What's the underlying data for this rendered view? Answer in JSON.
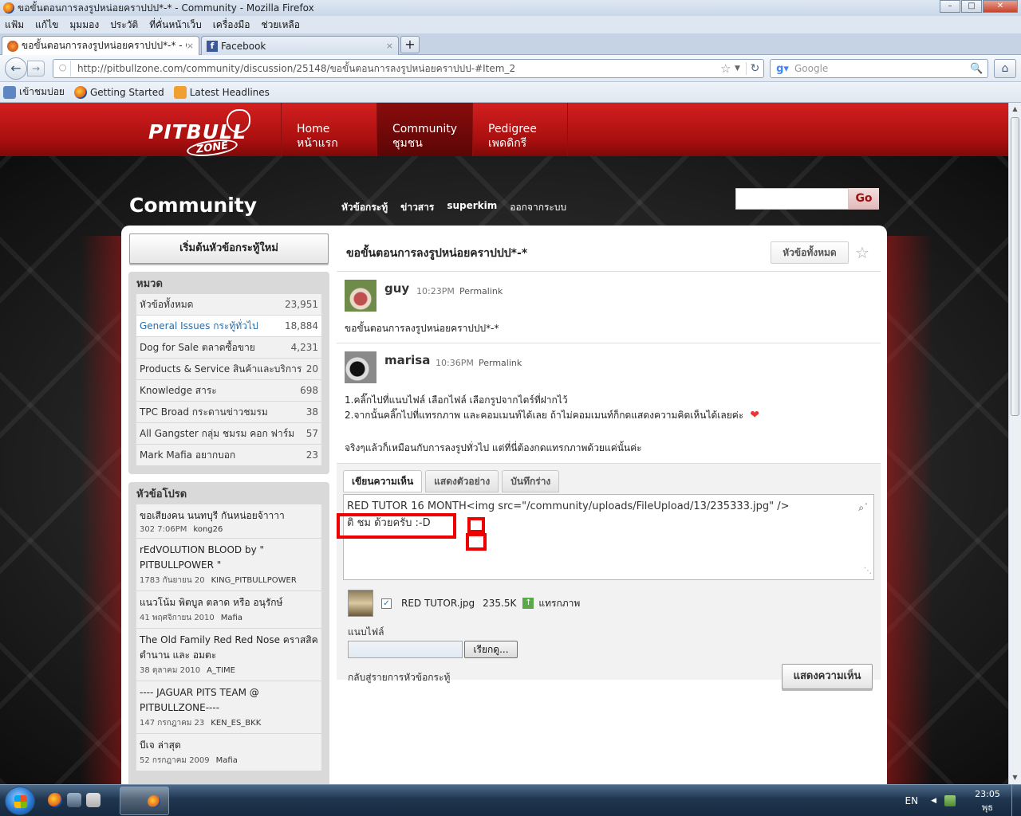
{
  "window": {
    "title": "ขอขั้นตอนการลงรูปหน่อยคราปปป*-* - Community - Mozilla Firefox",
    "controls": [
      "minimize",
      "maximize",
      "close"
    ]
  },
  "menu": [
    "แฟ้ม",
    "แก้ไข",
    "มุมมอง",
    "ประวัติ",
    "ที่คั่นหน้าเว็บ",
    "เครื่องมือ",
    "ช่วยเหลือ"
  ],
  "tabs": [
    {
      "label": "ขอขั้นตอนการลงรูปหน่อยคราปปป*-* - C..."
    },
    {
      "label": "Facebook"
    }
  ],
  "tab_close": "×",
  "new_tab": "+",
  "address": {
    "url": "http://pitbullzone.com/community/discussion/25148/ขอขั้นตอนการลงรูปหน่อยคราปปป-#Item_2"
  },
  "search_engine": {
    "placeholder": "Google"
  },
  "bookmarks": [
    "เข้าชมบ่อย",
    "Getting Started",
    "Latest Headlines"
  ],
  "site": {
    "logo_text": "PITBULL",
    "logo_sub": "ZONE",
    "nav": [
      {
        "en": "Home",
        "th": "หน้าแรก"
      },
      {
        "en": "Community",
        "th": "ชุมชน"
      },
      {
        "en": "Pedigree",
        "th": "เพดดิกรี"
      }
    ],
    "section_title": "Community",
    "subnav": [
      "หัวข้อกระทู้",
      "ข่าวสาร",
      "superkim",
      "ออกจากระบบ"
    ],
    "search_button": "Go"
  },
  "sidebar": {
    "start_button": "เริ่มต้นหัวข้อกระทู้ใหม่",
    "categories_header": "หมวด",
    "categories": [
      {
        "name": "หัวข้อทั้งหมด",
        "count": "23,951"
      },
      {
        "name": "General Issues กระทู้ทั่วไป",
        "count": "18,884"
      },
      {
        "name": "Dog for Sale ตลาดซื้อขาย",
        "count": "4,231"
      },
      {
        "name": "Products & Service สินค้าและบริการ",
        "count": "20"
      },
      {
        "name": "Knowledge สาระ",
        "count": "698"
      },
      {
        "name": "TPC Broad กระดานข่าวชมรม",
        "count": "38"
      },
      {
        "name": "All Gangster กลุ่ม ชมรม คอก ฟาร์ม",
        "count": "57"
      },
      {
        "name": "Mark Mafia อยากบอก",
        "count": "23"
      }
    ],
    "hot_header": "หัวข้อโปรด",
    "hot": [
      {
        "title": "ขอเสียงคน นนทบุรี กันหน่อยจ้าาาา",
        "count": "302",
        "date": "7:06PM",
        "user": "kong26"
      },
      {
        "title": "rEdVOLUTION BLOOD by \" PITBULLPOWER \"",
        "count": "1783",
        "date": "กันยายน 20",
        "user": "KING_PITBULLPOWER"
      },
      {
        "title": "แนวโน้ม พิตบูล ตลาด หรือ อนุรักษ์",
        "count": "41",
        "date": "พฤศจิกายน 2010",
        "user": "Mafia"
      },
      {
        "title": "The Old Family Red Red Nose คราสสิค ตำนาน และ อมตะ",
        "count": "38",
        "date": "ตุลาคม 2010",
        "user": "A_TIME"
      },
      {
        "title": "---- JAGUAR PITS TEAM @ PITBULLZONE----",
        "count": "147",
        "date": "กรกฎาคม 23",
        "user": "KEN_ES_BKK"
      },
      {
        "title": "บีเจ ล่าสุด",
        "count": "52",
        "date": "กรกฎาคม 2009",
        "user": "Mafia"
      }
    ]
  },
  "discussion": {
    "title": "ขอขั้นตอนการลงรูปหน่อยคราปปป*-*",
    "all_topics_button": "หัวข้อทั้งหมด",
    "posts": [
      {
        "author": "guy",
        "time": "10:23PM",
        "permalink": "Permalink",
        "lines": [
          "ขอขั้นตอนการลงรูปหน่อยคราปปป*-*"
        ]
      },
      {
        "author": "marisa",
        "time": "10:36PM",
        "permalink": "Permalink",
        "lines": [
          "1.คลิ๊กไปที่แนบไฟล์ เลือกไฟล์ เลือกรูปจากไดร์ที่ฝากไว้",
          "2.จากนั้นคลิ๊กไปที่แทรกภาพ และคอมเมนท์ได้เลย ถ้าไม่คอมเมนท์ก็กดแสดงความคิดเห็นได้เลยค่ะ",
          "จริงๆแล้วก็เหมือนกับการลงรูปทั่วไป แต่ที่นี่ต้องกดแทรกภาพด้วยแค่นั้นค่ะ"
        ]
      }
    ]
  },
  "editor": {
    "tabs": [
      "เขียนความเห็น",
      "แสดงตัวอย่าง",
      "บันทึกร่าง"
    ],
    "text_line1": "RED TUTOR 16 MONTH<img src=\"/community/uploads/FileUpload/13/235333.jpg\" />",
    "text_line2": "ติ ชม ด้วยครับ  :-D",
    "attachment": {
      "name": "RED TUTOR.jpg",
      "size": "235.5K",
      "insert_label": "แทรกภาพ"
    },
    "attach_label": "แนบไฟล์",
    "browse_button": "เรียกดู...",
    "back_link": "กลับสู่รายการหัวข้อกระทู้",
    "submit_button": "แสดงความเห็น"
  },
  "taskbar": {
    "language": "EN",
    "time": "23:05",
    "day": "พุธ"
  },
  "colors": {
    "brand_red": "#c0171a",
    "link_blue": "#2a6ea8",
    "annotation_red": "#ee0000"
  }
}
